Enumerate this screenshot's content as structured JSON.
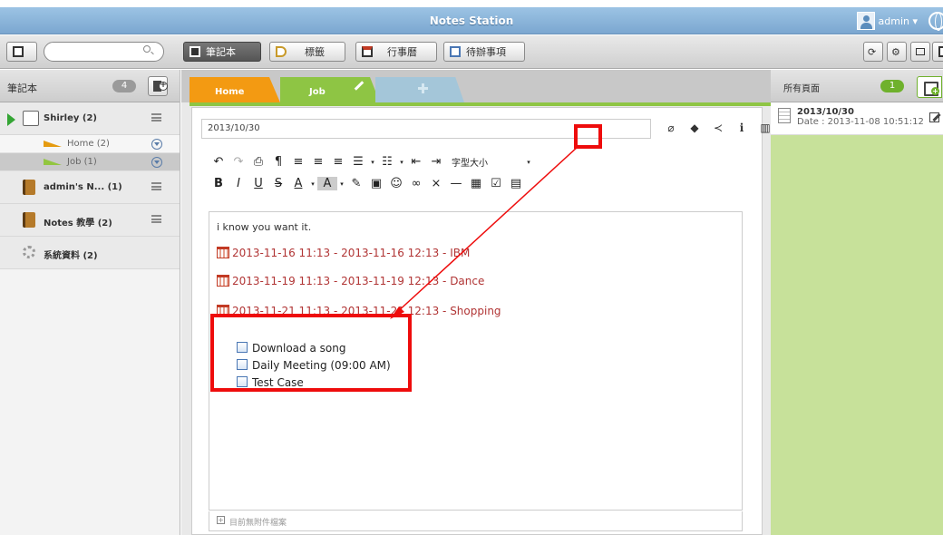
{
  "app": {
    "title": "Notes Station",
    "user": "admin ▾"
  },
  "toolbar": {
    "search_placeholder": "",
    "buttons": [
      {
        "label": "筆記本"
      },
      {
        "label": "標籤"
      },
      {
        "label": "行事曆"
      },
      {
        "label": "待辦事項"
      }
    ]
  },
  "sidebar": {
    "header": "筆記本",
    "count": "4",
    "notebooks": [
      {
        "name": "Shirley (2)"
      },
      {
        "name": "admin's N... (1)"
      },
      {
        "name": "Notes 教學 (2)"
      }
    ],
    "sections": [
      {
        "name": "Home  (2)"
      },
      {
        "name": "Job  (1)"
      }
    ],
    "system": {
      "name": "系統資料 (2)"
    }
  },
  "tabs": [
    {
      "label": "Home"
    },
    {
      "label": "Job"
    }
  ],
  "note": {
    "date_title": "2013/10/30",
    "font_size_label": "字型大小",
    "text": "i know you want it.",
    "events": [
      "2013-11-16 11:13 - 2013-11-16 12:13 - IBM",
      "2013-11-19 11:13 - 2013-11-19 12:13 - Dance",
      "2013-11-21 11:13 - 2013-11-21 12:13 - Shopping"
    ],
    "todos": [
      "Download a song",
      "Daily Meeting (09:00 AM)",
      "Test Case"
    ],
    "attachments_text": "目前無附件檔案"
  },
  "pages_panel": {
    "header": "所有頁面",
    "count": "1",
    "items": [
      {
        "title": "2013/10/30",
        "date": "Date : 2013-11-08 10:51:12"
      }
    ]
  },
  "colors": {
    "accent_green": "#8ec544",
    "home_orange": "#f39a12",
    "highlight_red": "#ee0c0c",
    "event_text": "#b13535"
  }
}
